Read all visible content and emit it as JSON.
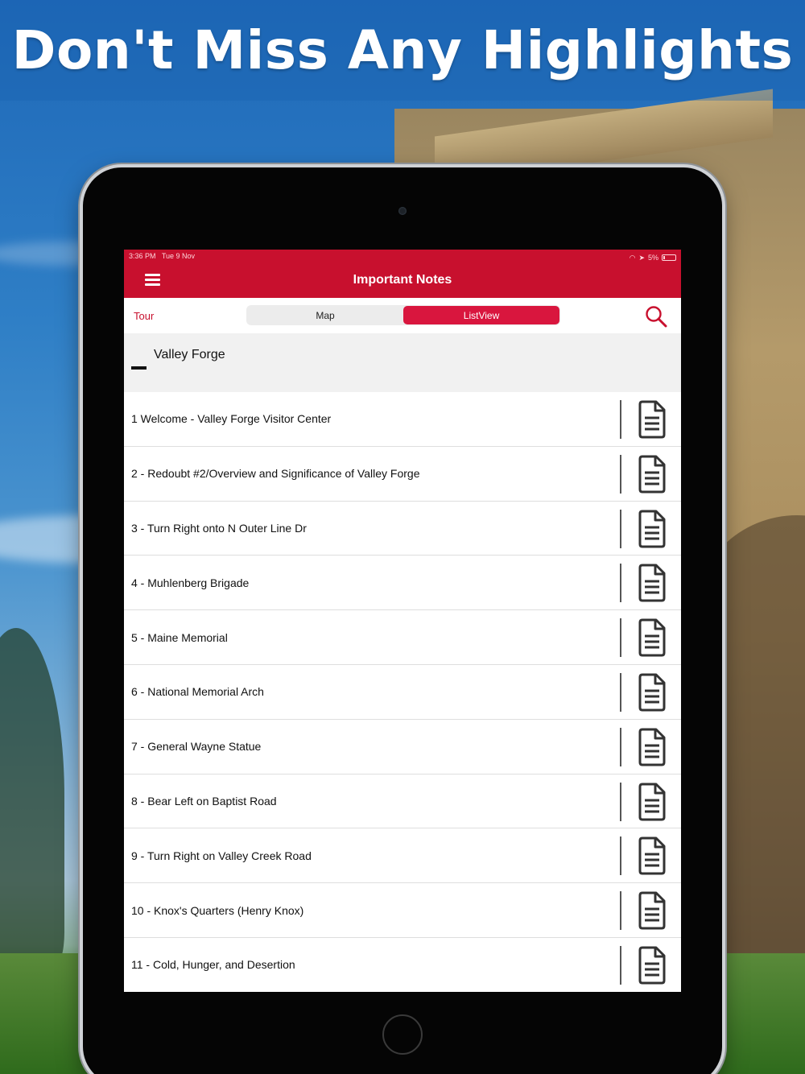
{
  "headline": "Don't Miss Any Highlights",
  "status_bar": {
    "time": "3:36 PM",
    "date": "Tue 9 Nov",
    "battery": "5%"
  },
  "app": {
    "title": "Important Notes",
    "accent_color": "#c8102e"
  },
  "toolbar": {
    "tour_label": "Tour",
    "tabs": [
      {
        "label": "Map",
        "active": false
      },
      {
        "label": "ListView",
        "active": true
      }
    ]
  },
  "section": {
    "title": "Valley Forge"
  },
  "stops": [
    {
      "label": "1 Welcome - Valley Forge Visitor Center"
    },
    {
      "label": "2 - Redoubt #2/Overview and Significance of Valley Forge"
    },
    {
      "label": "3 - Turn Right onto N Outer Line Dr"
    },
    {
      "label": "4 - Muhlenberg Brigade"
    },
    {
      "label": "5 - Maine Memorial"
    },
    {
      "label": "6 - National Memorial Arch"
    },
    {
      "label": "7 - General Wayne Statue"
    },
    {
      "label": "8 - Bear Left on Baptist Road"
    },
    {
      "label": "9 - Turn Right on Valley Creek Road"
    },
    {
      "label": "10 - Knox's Quarters (Henry Knox)"
    },
    {
      "label": "11 - Cold, Hunger, and Desertion"
    }
  ]
}
